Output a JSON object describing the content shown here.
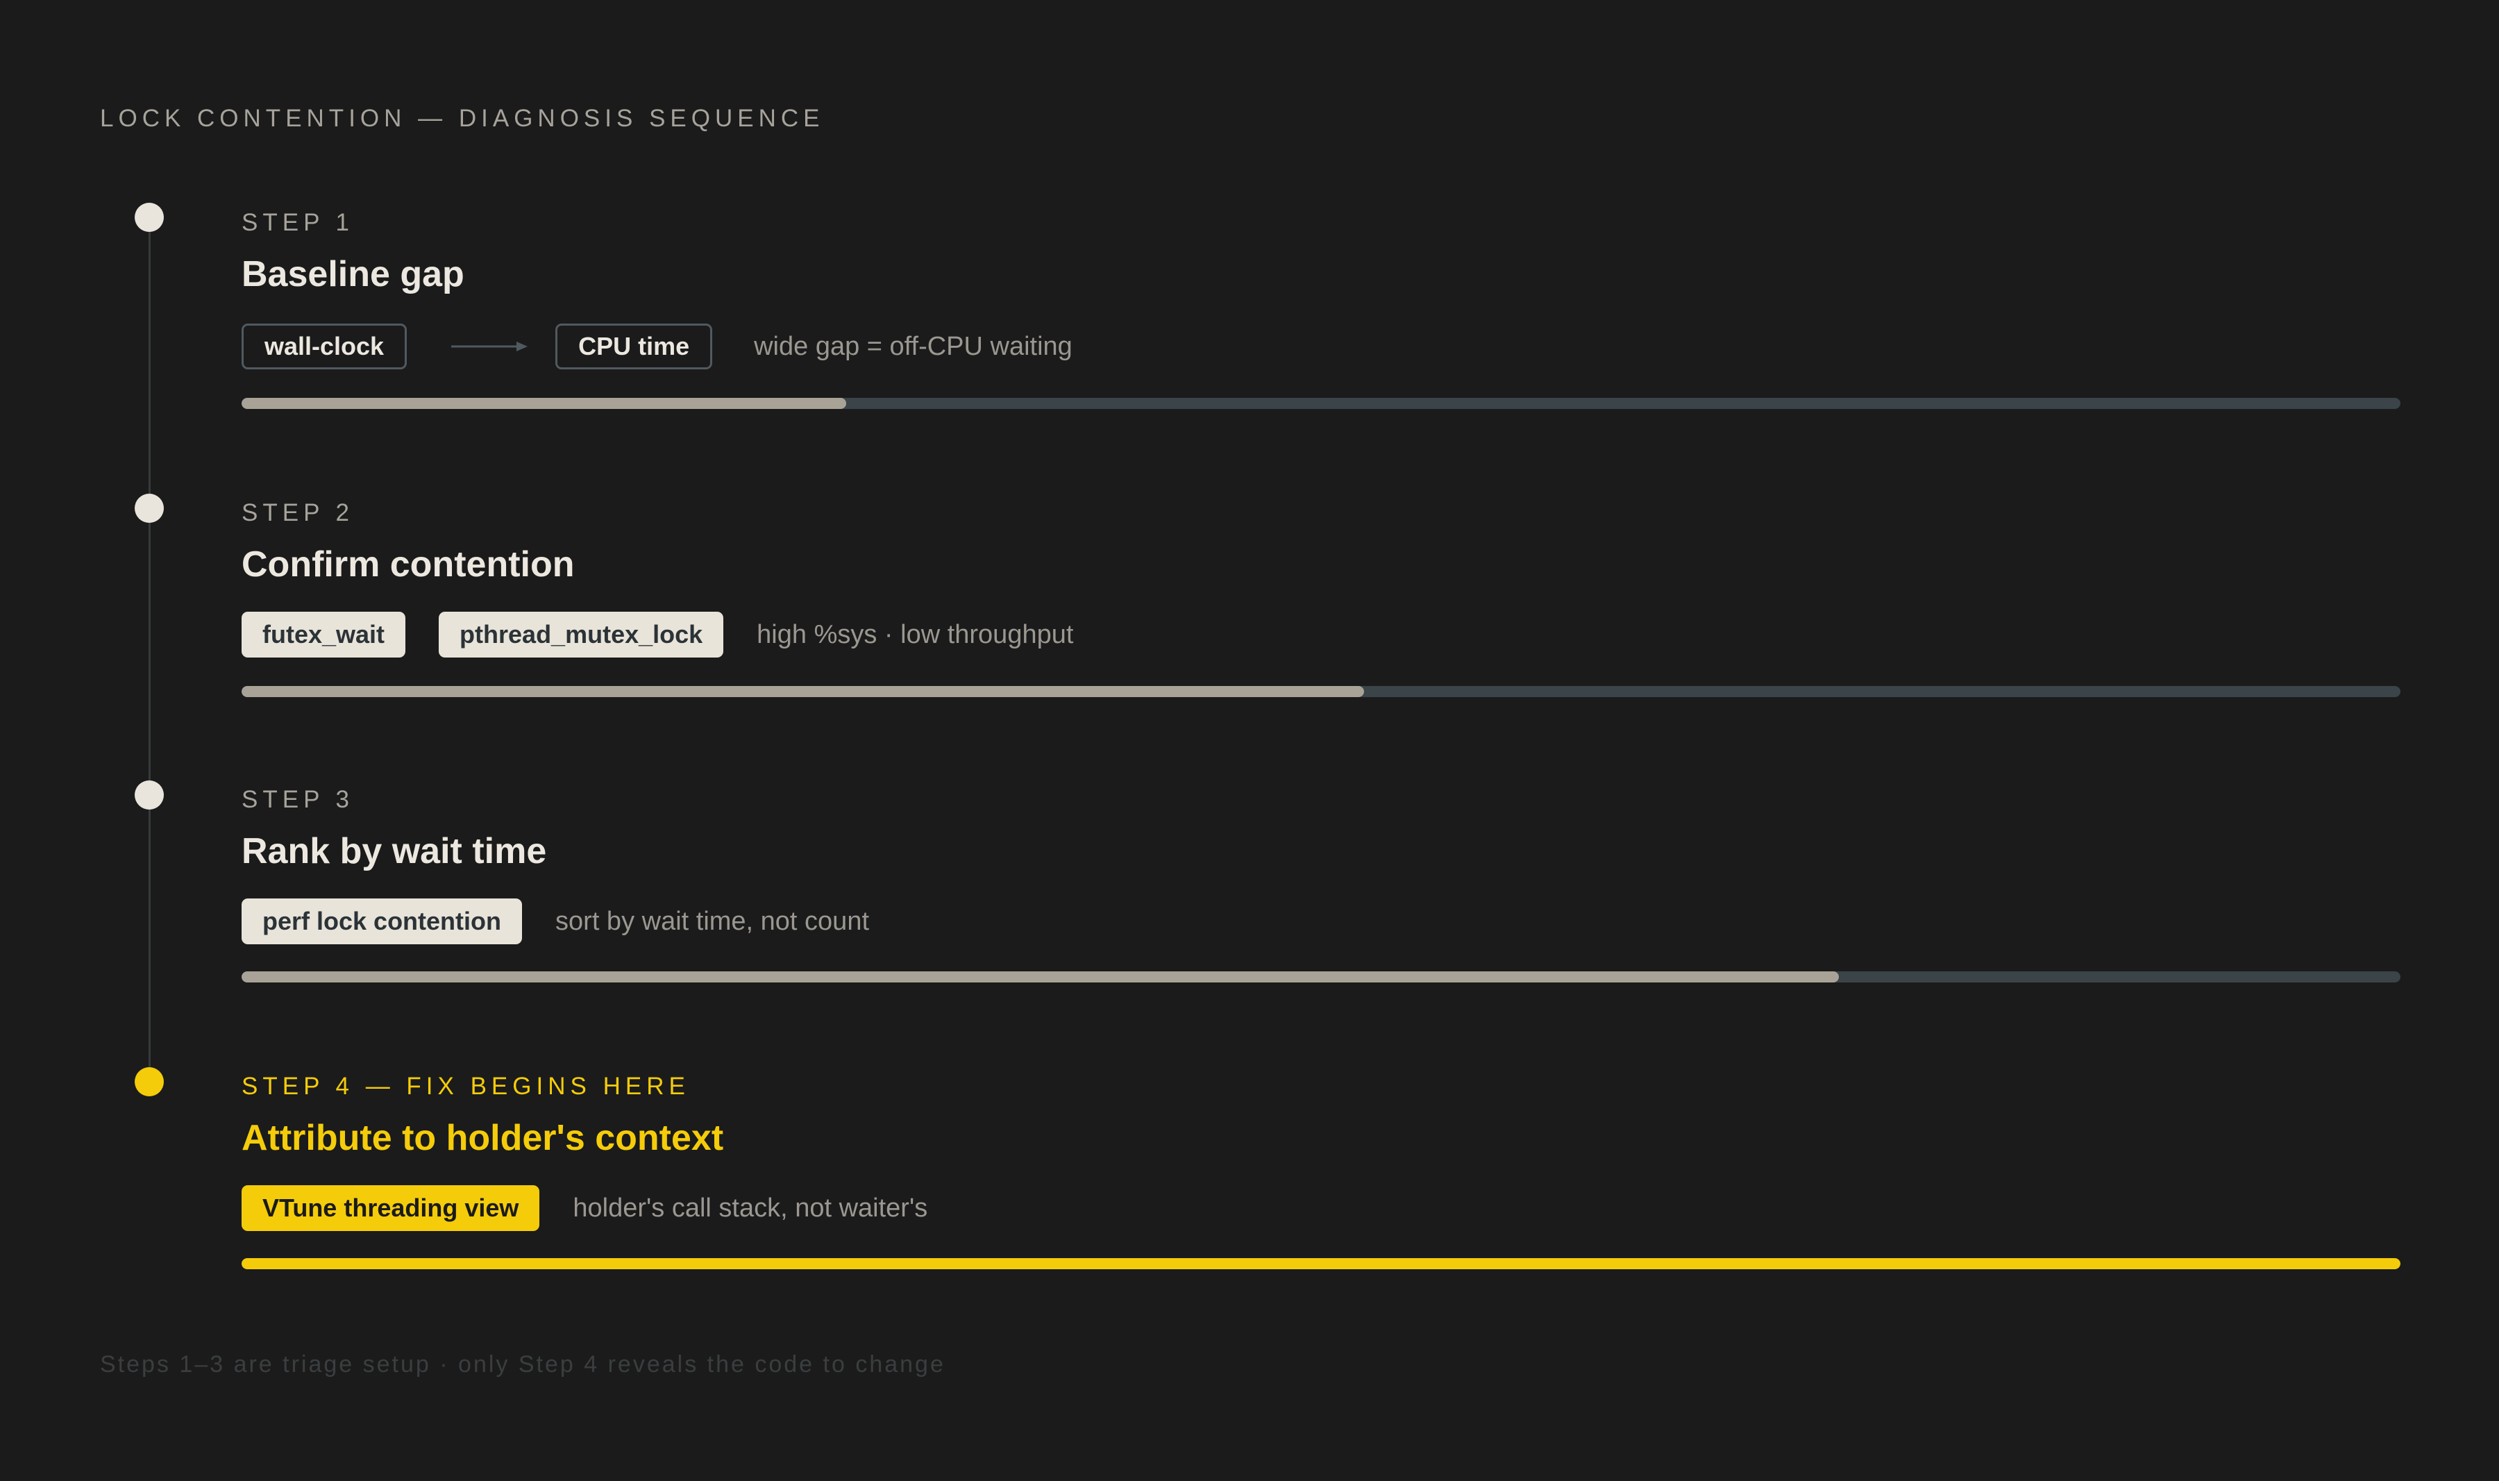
{
  "header": "LOCK CONTENTION — DIAGNOSIS SEQUENCE",
  "steps": [
    {
      "label": "STEP 1",
      "title": "Baseline gap",
      "pills": [
        "wall-clock",
        "CPU time"
      ],
      "note": "wide gap = off-CPU waiting",
      "progress": 0.28
    },
    {
      "label": "STEP 2",
      "title": "Confirm contention",
      "pills": [
        "futex_wait",
        "pthread_mutex_lock"
      ],
      "note": "high %sys · low throughput",
      "progress": 0.52
    },
    {
      "label": "STEP 3",
      "title": "Rank by wait time",
      "pills": [
        "perf lock contention"
      ],
      "note": "sort by wait time, not count",
      "progress": 0.74
    },
    {
      "label": "STEP 4 — FIX BEGINS HERE",
      "title": "Attribute to holder's context",
      "pills": [
        "VTune threading view"
      ],
      "note": "holder's call stack, not waiter's",
      "progress": 1.0
    }
  ],
  "footer": "Steps 1–3 are triage setup · only Step 4 reveals the code to change",
  "colors": {
    "background": "#1b1b1b",
    "accent": "#f5cc0a",
    "bar_track": "#3a4449",
    "bar_fill": "#a9a397"
  }
}
